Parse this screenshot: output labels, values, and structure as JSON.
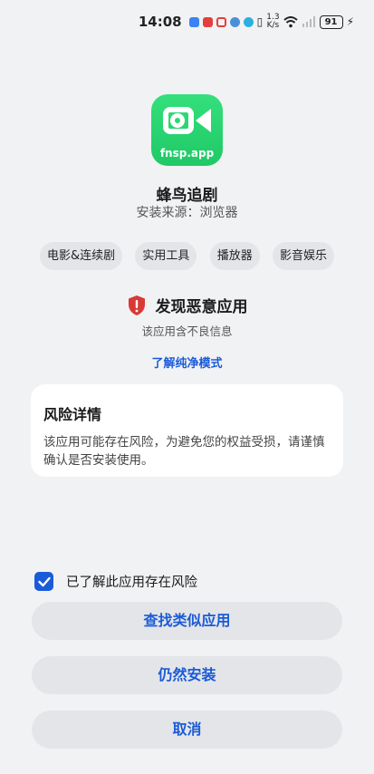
{
  "status_bar": {
    "time": "14:08",
    "net_speed_top": "1.3",
    "net_speed_bottom": "K/s",
    "battery": "91"
  },
  "app": {
    "icon_text": "fnsp.app",
    "name": "蜂鸟追剧",
    "source": "安装来源：浏览器"
  },
  "tags": [
    "电影&连续剧",
    "实用工具",
    "播放器",
    "影音娱乐"
  ],
  "warning": {
    "title": "发现恶意应用",
    "subtitle": "该应用含不良信息",
    "link": "了解纯净模式"
  },
  "risk_card": {
    "title": "风险详情",
    "description": "该应用可能存在风险，为避免您的权益受损，请谨慎确认是否安装使用。"
  },
  "agree": {
    "checked": true,
    "label": "已了解此应用存在风险"
  },
  "buttons": {
    "find_similar": "查找类似应用",
    "install_anyway": "仍然安装",
    "cancel": "取消"
  },
  "colors": {
    "accent": "#1a5bd8",
    "danger": "#d93a36",
    "app_icon": "#22cc6a",
    "background": "#f1f2f4"
  },
  "icons": [
    "shield-warning-icon",
    "checkbox-checked-icon",
    "wifi-icon",
    "battery-icon"
  ]
}
